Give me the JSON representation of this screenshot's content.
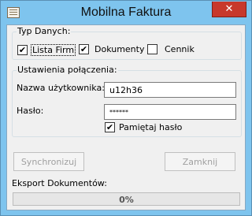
{
  "window": {
    "title": "Mobilna Faktura",
    "close_glyph": "✕",
    "icon": "document-icon"
  },
  "type_group": {
    "legend": "Typ Danych:",
    "options": [
      {
        "label": "Lista Firm",
        "checked": true
      },
      {
        "label": "Dokumenty",
        "checked": true
      },
      {
        "label": "Cennik",
        "checked": false
      }
    ]
  },
  "connection_group": {
    "legend": "Ustawienia połączenia:",
    "username_label": "Nazwa użytkownika:",
    "username_value": "u12h36",
    "password_label": "Hasło:",
    "password_value": "******",
    "remember": {
      "label": "Pamiętaj hasło",
      "checked": true
    }
  },
  "buttons": {
    "sync_label": "Synchronizuj",
    "close_label": "Zamknij"
  },
  "export": {
    "label": "Eksport Dokumentów:",
    "progress_percent": 0,
    "progress_text": "0%"
  },
  "colors": {
    "titlebar": "#7ec4ee",
    "close_button": "#c7382c",
    "progress_fill": "#06b025"
  }
}
